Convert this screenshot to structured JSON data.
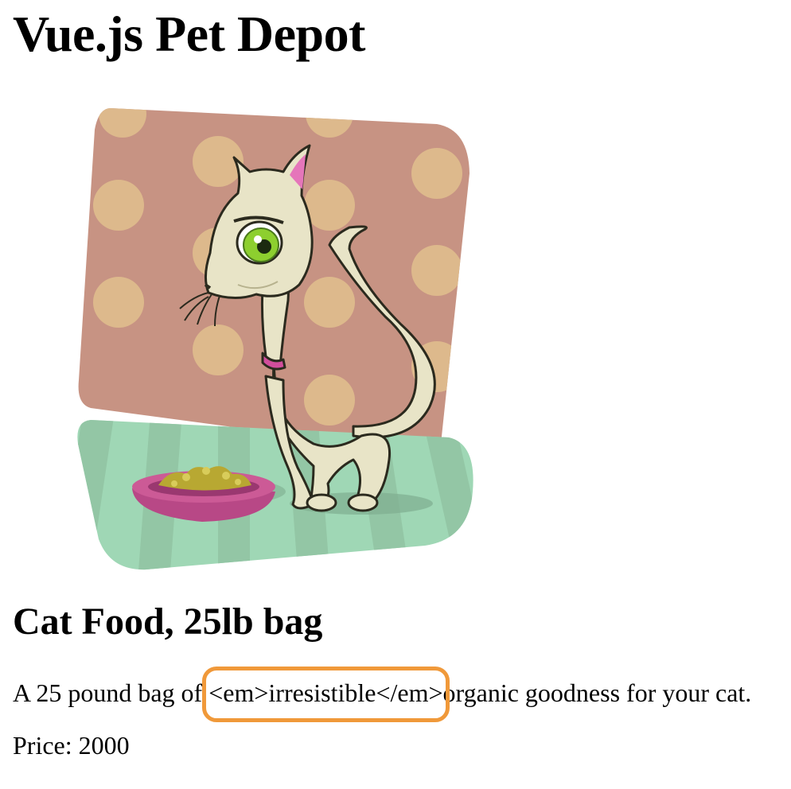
{
  "header": {
    "site_title": "Vue.js Pet Depot"
  },
  "product": {
    "image_icon": "cat-with-food-bowl-illustration",
    "name": "Cat Food, 25lb bag",
    "description_before": "A 25 pound bag of ",
    "description_raw_html": "<em>irresistible</em>",
    "description_after": "organic goodness for your cat.",
    "price_label": "Price: ",
    "price_value": "2000"
  },
  "colors": {
    "highlight_outline": "#f0993a",
    "wall": "#c79383",
    "polka_dot": "#ddb98c",
    "floor": "#9fd7b5",
    "bowl": "#cc5a96",
    "cat_body": "#e8e4c7",
    "cat_eye": "#8dcf2f"
  }
}
